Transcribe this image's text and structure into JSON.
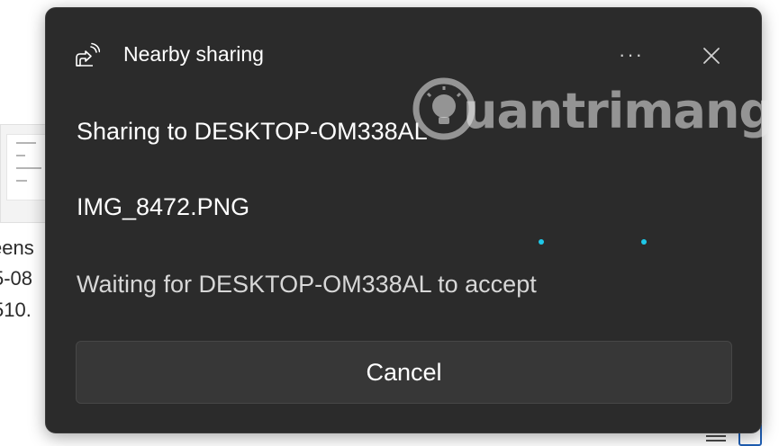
{
  "background": {
    "text_lines": [
      "eens",
      "5-08",
      "510."
    ]
  },
  "dialog": {
    "title": "Nearby sharing",
    "more_label": "···",
    "sharing_to": "Sharing to DESKTOP-OM338AL",
    "filename": "IMG_8472.PNG",
    "status": "Waiting for DESKTOP-OM338AL to accept",
    "cancel_label": "Cancel",
    "icons": {
      "share": "nearby-share-icon",
      "close": "close-icon",
      "more": "more-icon"
    }
  },
  "watermark": {
    "text": "uantrimang",
    "icon": "lightbulb-icon"
  },
  "colors": {
    "dialog_bg": "#2b2b2b",
    "button_bg": "#373737",
    "progress_dot": "#1ec8e8",
    "text": "#ffffff"
  }
}
